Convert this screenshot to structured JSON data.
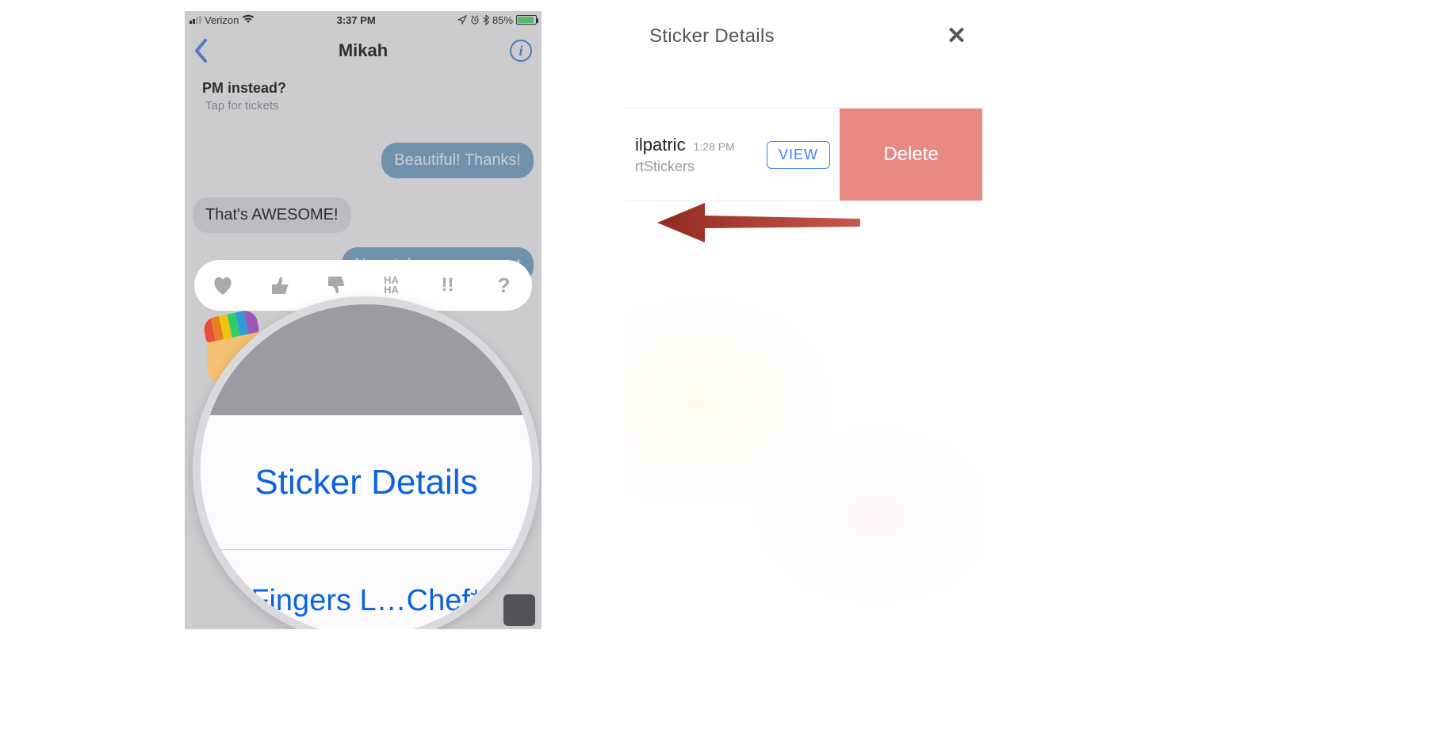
{
  "left": {
    "status": {
      "carrier": "Verizon",
      "time": "3:37 PM",
      "battery_pct": "85%"
    },
    "nav": {
      "title": "Mikah"
    },
    "messages": {
      "m1_line1": "PM instead?",
      "m1_sub": "Tap for tickets",
      "m2": "Beautiful! Thanks!",
      "m3": "That's AWESOME!",
      "m4": "Now, take your man out"
    },
    "tapback": {
      "haha": "HA HA",
      "exclaim": "!!",
      "question": "?"
    },
    "zoom": {
      "sticker_details": "Sticker Details",
      "secondary": "Fingers L…Chef* "
    }
  },
  "right": {
    "header": {
      "title": "Sticker Details",
      "close": "✕"
    },
    "row": {
      "name_fragment": "ilpatric",
      "time": "1:28 PM",
      "sub_fragment": "rtStickers",
      "view_label": "VIEW",
      "delete_label": "Delete"
    }
  },
  "icons": {
    "rainbow_fist": "rainbow-fist-sticker"
  }
}
